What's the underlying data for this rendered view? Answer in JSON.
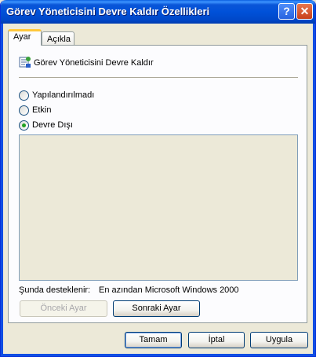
{
  "window": {
    "title": "Görev Yöneticisini Devre Kaldır Özellikleri",
    "help_label": "?",
    "close_label": "✕"
  },
  "tabs": [
    {
      "label": "Ayar",
      "active": true
    },
    {
      "label": "Açıkla",
      "active": false
    }
  ],
  "policy": {
    "name": "Görev Yöneticisini Devre Kaldır",
    "icon": "policy-settings-icon"
  },
  "options": [
    {
      "label": "Yapılandırılmadı",
      "checked": false
    },
    {
      "label": "Etkin",
      "checked": false
    },
    {
      "label": "Devre Dışı",
      "checked": true
    }
  ],
  "supported": {
    "label": "Şunda desteklenir:",
    "value": "En azından Microsoft Windows 2000"
  },
  "nav": {
    "prev_label": "Önceki Ayar",
    "next_label": "Sonraki Ayar"
  },
  "footer": {
    "ok_label": "Tamam",
    "cancel_label": "İptal",
    "apply_label": "Uygula"
  }
}
